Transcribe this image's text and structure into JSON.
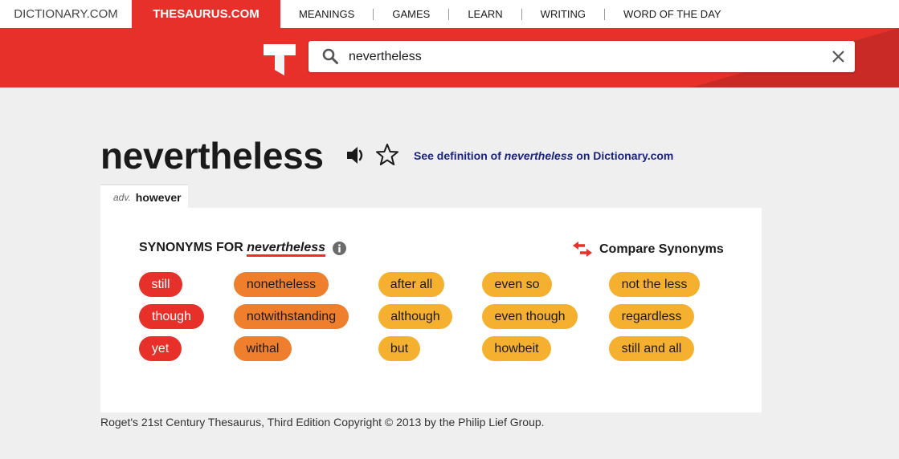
{
  "topnav": {
    "dictionary_tab": "DICTIONARY.COM",
    "thesaurus_tab": "THESAURUS.COM",
    "links": [
      "MEANINGS",
      "GAMES",
      "LEARN",
      "WRITING",
      "WORD OF THE DAY"
    ]
  },
  "search": {
    "value": "nevertheless"
  },
  "entry": {
    "headword": "nevertheless",
    "definition_link": {
      "prefix": "See definition of ",
      "word": "nevertheless",
      "suffix": " on Dictionary.com"
    },
    "sense": {
      "pos": "adv.",
      "word": "however"
    }
  },
  "synonyms": {
    "heading_prefix": "SYNONYMS FOR ",
    "heading_word": "nevertheless",
    "compare_label": "Compare Synonyms",
    "items": [
      {
        "word": "still",
        "relevance": "high"
      },
      {
        "word": "though",
        "relevance": "high"
      },
      {
        "word": "yet",
        "relevance": "high"
      },
      {
        "word": "nonetheless",
        "relevance": "medium"
      },
      {
        "word": "notwithstanding",
        "relevance": "medium"
      },
      {
        "word": "withal",
        "relevance": "medium"
      },
      {
        "word": "after all",
        "relevance": "low"
      },
      {
        "word": "although",
        "relevance": "low"
      },
      {
        "word": "but",
        "relevance": "low"
      },
      {
        "word": "even so",
        "relevance": "low"
      },
      {
        "word": "even though",
        "relevance": "low"
      },
      {
        "word": "howbeit",
        "relevance": "low"
      },
      {
        "word": "not the less",
        "relevance": "low"
      },
      {
        "word": "regardless",
        "relevance": "low"
      },
      {
        "word": "still and all",
        "relevance": "low"
      }
    ]
  },
  "colors": {
    "brand_red": "#e8302a",
    "pill_high_bg": "#e8302a",
    "pill_high_text": "#ffffff",
    "pill_medium_bg": "#ef7f2c",
    "pill_medium_text": "#1a1a1a",
    "pill_low_bg": "#f6b02f",
    "pill_low_text": "#1a1a1a",
    "link_navy": "#1a237e"
  },
  "footer": {
    "copyright": "Roget's 21st Century Thesaurus, Third Edition Copyright © 2013 by the Philip Lief Group."
  }
}
